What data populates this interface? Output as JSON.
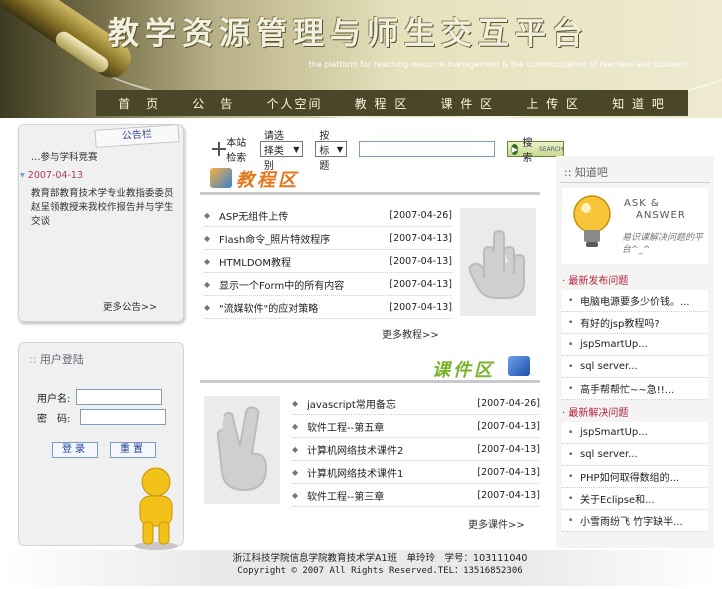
{
  "site": {
    "title": "教学资源管理与师生交互平台",
    "subtitle": "the platform for teaching resource management & the communication of teachers and students"
  },
  "nav": [
    "首　页",
    "公　告",
    "个人空间",
    "教 程 区",
    "课 件 区",
    "上 传 区",
    "知 道 吧"
  ],
  "notice": {
    "tab": "公告栏",
    "partial_text": "…参与学科竞赛",
    "date": "2007-04-13",
    "text": "教育部教育技术学专业教指委委员赵呈领教授来我校作报告并与学生交谈",
    "more": "更多公告>>"
  },
  "login": {
    "title": "用户登陆",
    "username_label": "用户名:",
    "password_label": "密　码:",
    "login_button": "登录",
    "reset_button": "重置"
  },
  "search": {
    "label": "本站检索",
    "category_select": "请选择类别",
    "field_select": "按标题",
    "button": "搜索",
    "button_en": "SEARCH"
  },
  "tutorials": {
    "title": "教程区",
    "items": [
      {
        "title": "ASP无组件上传",
        "date": "[2007-04-26]"
      },
      {
        "title": "Flash命令_照片特效程序",
        "date": "[2007-04-13]"
      },
      {
        "title": "HTMLDOM教程",
        "date": "[2007-04-13]"
      },
      {
        "title": "显示一个Form中的所有内容",
        "date": "[2007-04-13]"
      },
      {
        "title": "\"流媒软件\"的应对策略",
        "date": "[2007-04-13]"
      }
    ],
    "more": "更多教程>>"
  },
  "courseware": {
    "title": "课件区",
    "items": [
      {
        "title": "javascript常用备忘",
        "date": "[2007-04-26]"
      },
      {
        "title": "软件工程--第五章",
        "date": "[2007-04-13]"
      },
      {
        "title": "计算机网络技术课件2",
        "date": "[2007-04-13]"
      },
      {
        "title": "计算机网络技术课件1",
        "date": "[2007-04-13]"
      },
      {
        "title": "软件工程--第三章",
        "date": "[2007-04-13]"
      }
    ],
    "more": "更多课件>>"
  },
  "zhidao": {
    "title": "知道吧",
    "ask_title_1": "ASK &",
    "ask_title_2": "ANSWER",
    "ask_desc": "易识课解决问题的平台^_^",
    "latest_questions_title": "最新发布问题",
    "latest_questions": [
      "电脑电源要多少价钱。...",
      "有好的jsp教程吗?",
      "jspSmartUp...",
      "sql server...",
      "高手帮帮忙~~急!!..."
    ],
    "solved_questions_title": "最新解决问题",
    "solved_questions": [
      "jspSmartUp...",
      "sql server...",
      "PHP如何取得数组的...",
      "关于Eclipse和...",
      "小雪雨纷飞 竹字缺半..."
    ]
  },
  "footer": {
    "line1": "浙江科技学院信息学院教育技术学A1班　单玲玲　学号：103111040",
    "line2": "Copyright © 2007 All Rights Reserved.TEL：13516852306"
  },
  "colors": {
    "nav_bg": "#4a4628",
    "accent_orange": "#e3771a",
    "accent_green": "#79b42a",
    "question_red": "#b5213a"
  }
}
